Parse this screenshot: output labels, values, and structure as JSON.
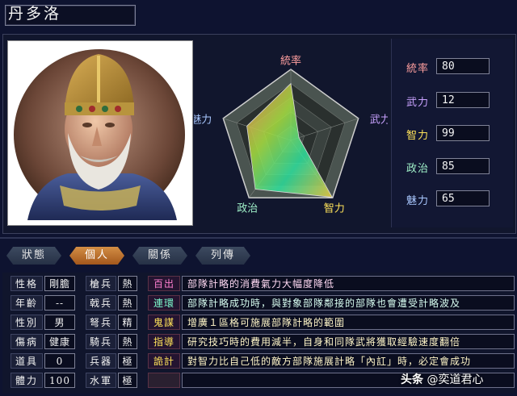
{
  "general": {
    "name": "丹多洛"
  },
  "radar": {
    "axes": [
      "統率",
      "武力",
      "智力",
      "政治",
      "魅力"
    ],
    "axis_colors": [
      "#ff9f9f",
      "#c9a2ff",
      "#ffe35a",
      "#9ff0c8",
      "#a9c8ff"
    ],
    "values": [
      80,
      12,
      99,
      85,
      65
    ],
    "max": 100
  },
  "stats": [
    {
      "label": "統率",
      "value": "80",
      "color": "#ff9f9f"
    },
    {
      "label": "武力",
      "value": "12",
      "color": "#c9a2ff"
    },
    {
      "label": "智力",
      "value": "99",
      "color": "#ffe35a"
    },
    {
      "label": "政治",
      "value": "85",
      "color": "#9ff0c8"
    },
    {
      "label": "魅力",
      "value": "65",
      "color": "#a9c8ff"
    }
  ],
  "tabs": [
    "狀態",
    "個人",
    "關係",
    "列傳"
  ],
  "active_tab": "個人",
  "personal": [
    {
      "label": "性格",
      "value": "剛膽"
    },
    {
      "label": "年齡",
      "value": "--"
    },
    {
      "label": "性別",
      "value": "男"
    },
    {
      "label": "傷病",
      "value": "健康"
    },
    {
      "label": "道具",
      "value": "0"
    },
    {
      "label": "體力",
      "value": "100"
    }
  ],
  "troops": [
    {
      "label": "槍兵",
      "value": "熱"
    },
    {
      "label": "戟兵",
      "value": "熱"
    },
    {
      "label": "弩兵",
      "value": "精"
    },
    {
      "label": "騎兵",
      "value": "熱"
    },
    {
      "label": "兵器",
      "value": "極"
    },
    {
      "label": "水軍",
      "value": "極"
    }
  ],
  "skills": [
    {
      "name": "百出",
      "desc": "部隊計略的消費氣力大幅度降低"
    },
    {
      "name": "連環",
      "desc": "部隊計略成功時，與對象部隊鄰接的部隊也會遭受計略波及"
    },
    {
      "name": "鬼謀",
      "desc": "增廣１區格可施展部隊計略的範圍"
    },
    {
      "name": "指導",
      "desc": "研究技巧時的費用減半，自身和同隊武將獲取經驗速度翻倍"
    },
    {
      "name": "詭計",
      "desc": "對智力比自己低的敵方部隊施展計略「內訌」時，必定會成功"
    },
    {
      "name": "",
      "desc": ""
    }
  ],
  "watermark": {
    "logo": "头条",
    "handle": "@奕道君心"
  }
}
